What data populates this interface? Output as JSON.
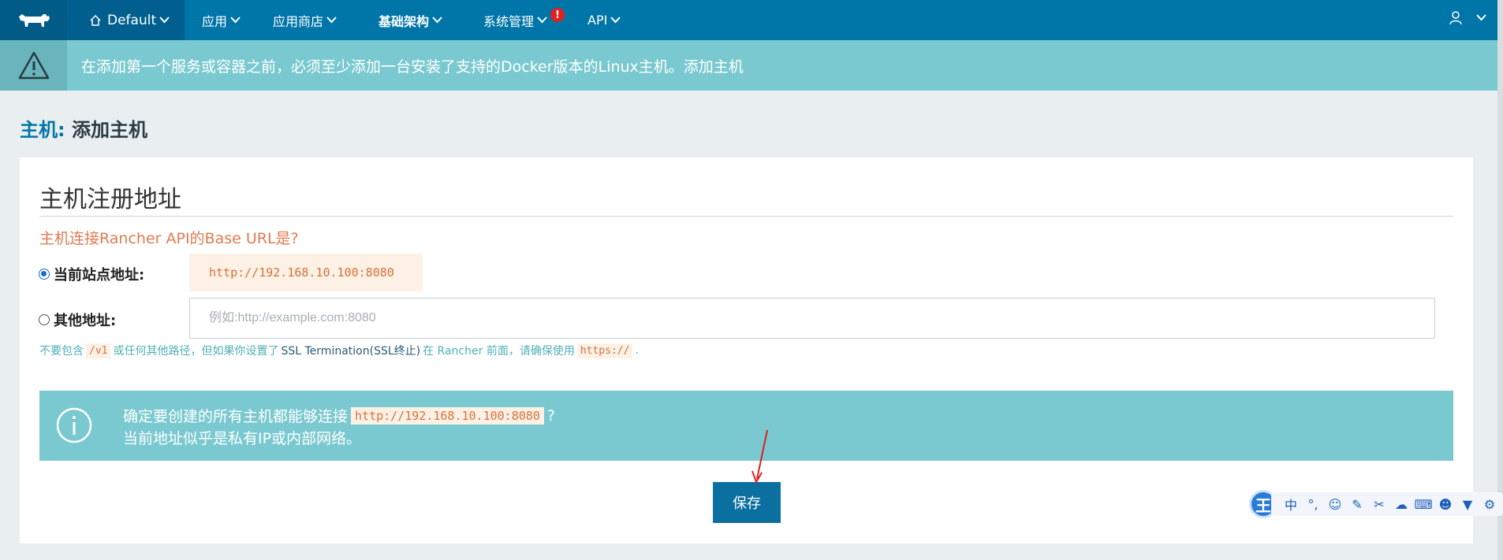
{
  "nav": {
    "environment": "Default",
    "items": [
      "应用",
      "应用商店",
      "基础架构",
      "系统管理",
      "API"
    ],
    "alert_badge": "!"
  },
  "warning": {
    "text_before": "在添加第一个服务或容器之前，必须至少添加一台安装了",
    "link_docker": "支持的Docker版本",
    "text_middle": " 的Linux主机。",
    "link_add_host": "添加主机"
  },
  "page": {
    "title_prefix": "主机:",
    "title_main": " 添加主机"
  },
  "card": {
    "title": "主机注册地址",
    "question": "主机连接Rancher API的Base URL是?",
    "option_current_label": "当前站点地址:",
    "option_current_url": "http://192.168.10.100:8080",
    "option_other_label": "其他地址:",
    "option_other_placeholder": "例如:http://example.com:8080",
    "help_1": "不要包含",
    "help_code_1": "/v1",
    "help_2": "或任何其他路径，但如果你设置了",
    "help_strong": "SSL Termination(SSL终止)",
    "help_3": "在 Rancher 前面，请确保使用",
    "help_code_2": "https://",
    "help_4": "."
  },
  "info": {
    "line1_before": "确定要创建的所有主机都能够连接",
    "line1_code": "http://192.168.10.100:8080",
    "line1_after": "?",
    "line2": "当前地址似乎是私有IP或内部网络。"
  },
  "actions": {
    "save": "保存"
  },
  "ime": {
    "logo": "王",
    "lang": "中"
  },
  "colors": {
    "nav_bg": "#0075a8",
    "warning_bg": "#7ac9d0",
    "accent_orange": "#e07b52",
    "button_bg": "#0b6fa0"
  }
}
